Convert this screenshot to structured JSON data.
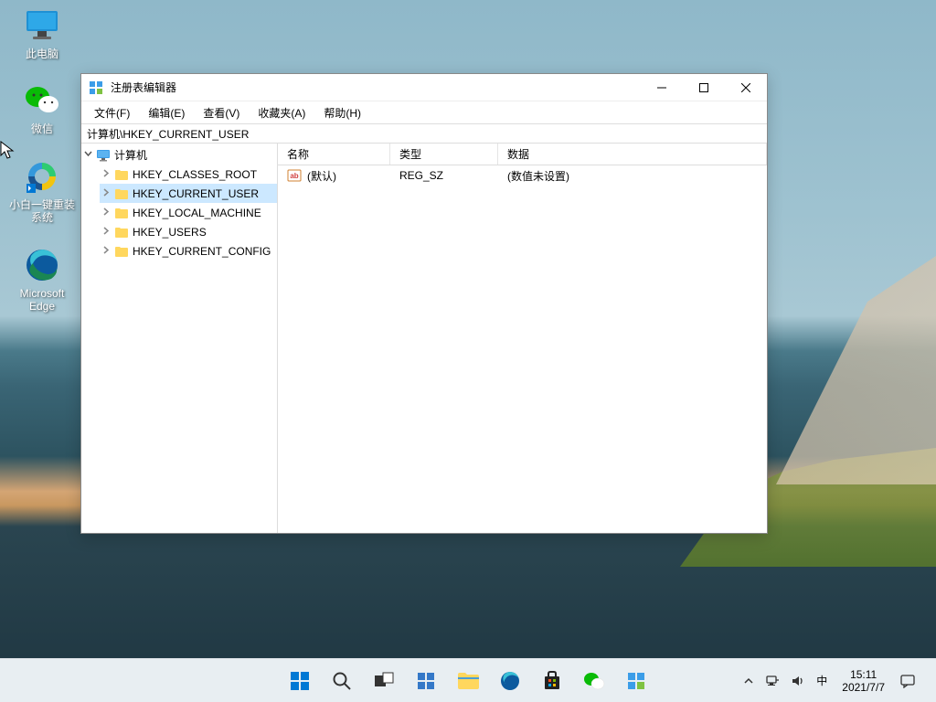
{
  "desktop_icons": [
    {
      "name": "此电脑",
      "icon": "monitor"
    },
    {
      "name": "微信",
      "icon": "wechat"
    },
    {
      "name": "小白一键重装系统",
      "icon": "xiaobai"
    },
    {
      "name": "Microsoft Edge",
      "icon": "edge"
    }
  ],
  "window": {
    "title": "注册表编辑器",
    "menu": [
      {
        "label": "文件(F)"
      },
      {
        "label": "编辑(E)"
      },
      {
        "label": "查看(V)"
      },
      {
        "label": "收藏夹(A)"
      },
      {
        "label": "帮助(H)"
      }
    ],
    "address": "计算机\\HKEY_CURRENT_USER",
    "tree": {
      "root": "计算机",
      "hives": [
        "HKEY_CLASSES_ROOT",
        "HKEY_CURRENT_USER",
        "HKEY_LOCAL_MACHINE",
        "HKEY_USERS",
        "HKEY_CURRENT_CONFIG"
      ],
      "selected_index": 1
    },
    "columns": {
      "name": "名称",
      "type": "类型",
      "data": "数据"
    },
    "rows": [
      {
        "name": "(默认)",
        "type": "REG_SZ",
        "data": "(数值未设置)"
      }
    ]
  },
  "taskbar": {
    "time": "15:11",
    "date": "2021/7/7",
    "ime": "中"
  }
}
